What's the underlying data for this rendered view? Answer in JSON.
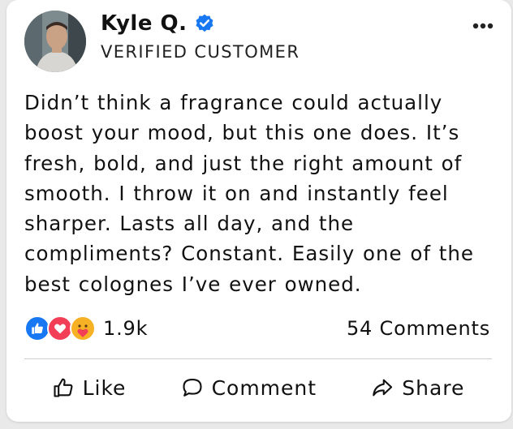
{
  "post": {
    "author": {
      "name": "Kyle Q.",
      "subtitle": "VERIFIED CUSTOMER",
      "avatar_icon": "avatar-photo",
      "verified_icon": "verified-badge-icon"
    },
    "menu_icon": "more-options-icon",
    "text": "Didn’t think a fragrance could actually boost your mood, but this one does. It’s fresh, bold, and just the right amount of smooth. I throw it on and instantly feel sharper. Lasts all day, and the compliments? Constant. Easily one of the best colognes I’ve ever owned.",
    "reactions": {
      "icons": [
        "like-reaction-icon",
        "love-reaction-icon",
        "care-reaction-icon"
      ],
      "count": "1.9k"
    },
    "comments_label": "54 Comments",
    "actions": {
      "like": "Like",
      "comment": "Comment",
      "share": "Share"
    }
  },
  "colors": {
    "verified_blue": "#1877f2",
    "like_blue": "#1877f2",
    "love_red": "#f33e58",
    "care_yellow": "#f7b125",
    "divider": "#cfcfcf"
  }
}
